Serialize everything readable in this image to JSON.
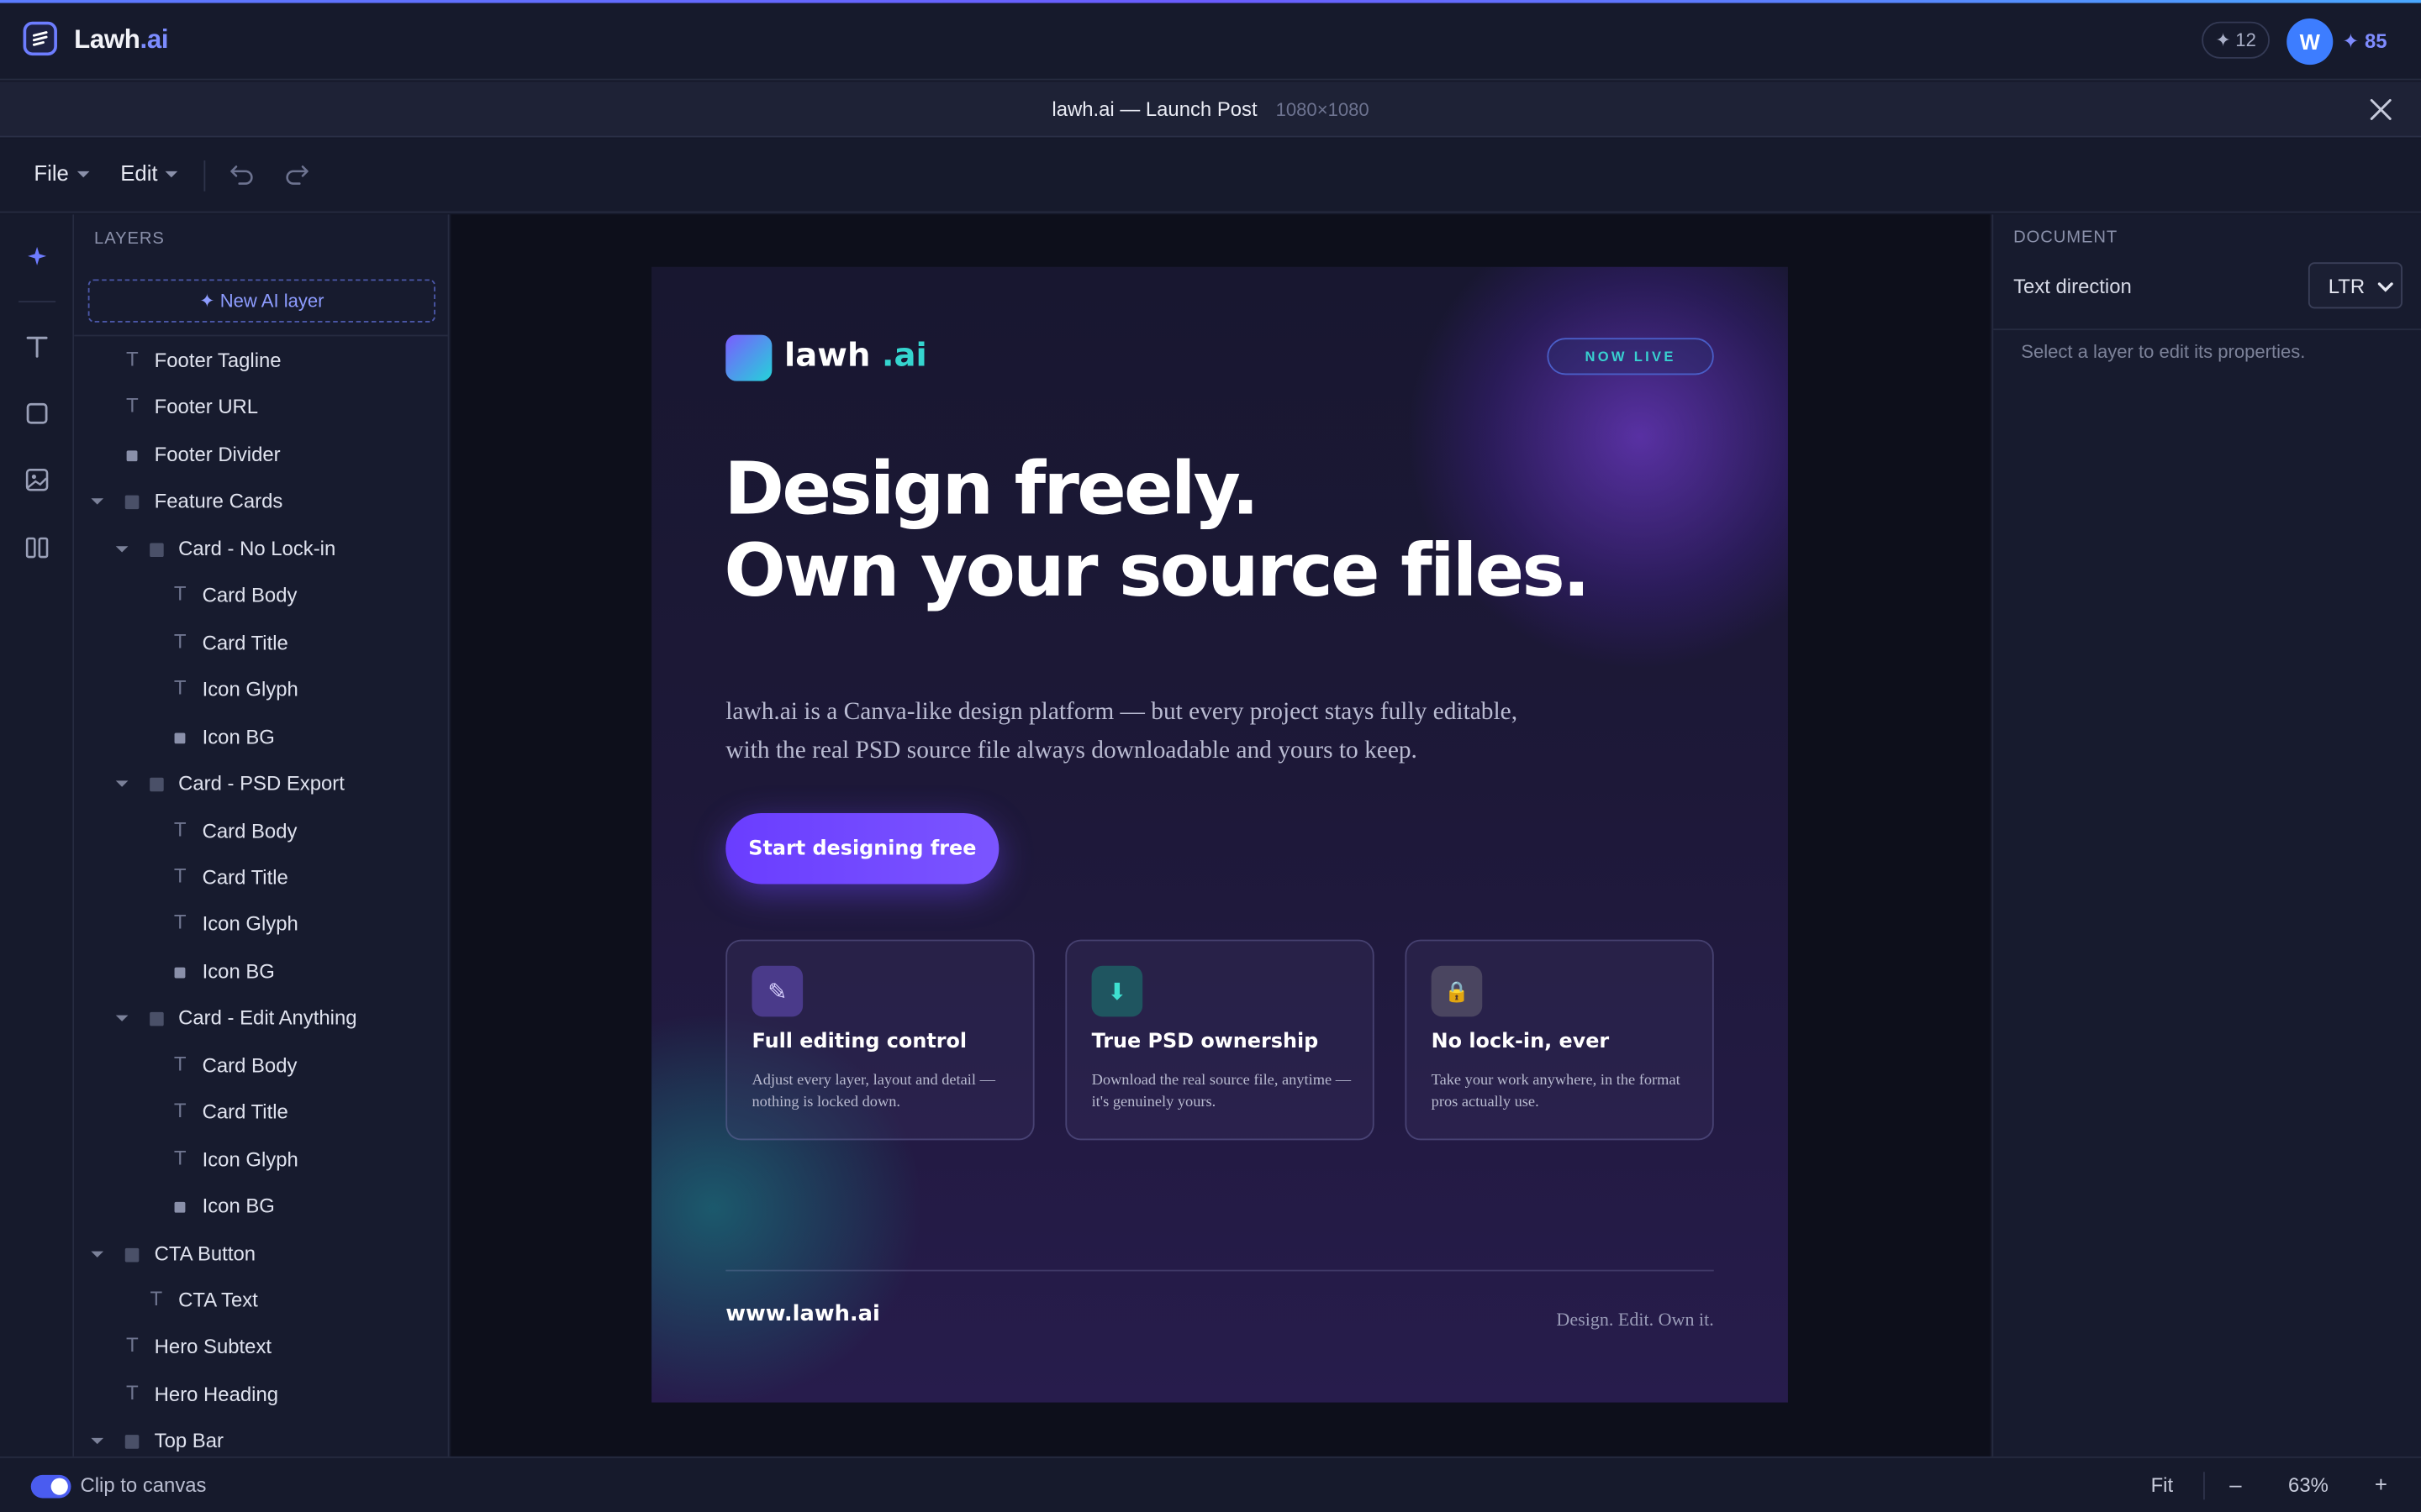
{
  "app": {
    "brand_name": "Lawh",
    "brand_suffix": ".ai",
    "credits_badge": "12",
    "avatar_initial": "W",
    "points": "85",
    "accent": "#5b7cff"
  },
  "document": {
    "title": "lawh.ai — Launch Post",
    "dimensions": "1080×1080"
  },
  "toolbar": {
    "file_label": "File",
    "edit_label": "Edit"
  },
  "layers": {
    "header": "LAYERS",
    "new_ai_label": "✦ New AI layer",
    "items": [
      {
        "label": "Footer Tagline",
        "kind": "text",
        "depth": 0,
        "expandable": false
      },
      {
        "label": "Footer URL",
        "kind": "text",
        "depth": 0,
        "expandable": false
      },
      {
        "label": "Footer Divider",
        "kind": "shape",
        "depth": 0,
        "expandable": false
      },
      {
        "label": "Feature Cards",
        "kind": "group",
        "depth": 0,
        "expandable": true
      },
      {
        "label": "Card - No Lock-in",
        "kind": "group",
        "depth": 1,
        "expandable": true
      },
      {
        "label": "Card Body",
        "kind": "text",
        "depth": 2,
        "expandable": false
      },
      {
        "label": "Card Title",
        "kind": "text",
        "depth": 2,
        "expandable": false
      },
      {
        "label": "Icon Glyph",
        "kind": "text",
        "depth": 2,
        "expandable": false
      },
      {
        "label": "Icon BG",
        "kind": "shape",
        "depth": 2,
        "expandable": false
      },
      {
        "label": "Card - PSD Export",
        "kind": "group",
        "depth": 1,
        "expandable": true
      },
      {
        "label": "Card Body",
        "kind": "text",
        "depth": 2,
        "expandable": false
      },
      {
        "label": "Card Title",
        "kind": "text",
        "depth": 2,
        "expandable": false
      },
      {
        "label": "Icon Glyph",
        "kind": "text",
        "depth": 2,
        "expandable": false
      },
      {
        "label": "Icon BG",
        "kind": "shape",
        "depth": 2,
        "expandable": false
      },
      {
        "label": "Card - Edit Anything",
        "kind": "group",
        "depth": 1,
        "expandable": true
      },
      {
        "label": "Card Body",
        "kind": "text",
        "depth": 2,
        "expandable": false
      },
      {
        "label": "Card Title",
        "kind": "text",
        "depth": 2,
        "expandable": false
      },
      {
        "label": "Icon Glyph",
        "kind": "text",
        "depth": 2,
        "expandable": false
      },
      {
        "label": "Icon BG",
        "kind": "shape",
        "depth": 2,
        "expandable": false
      },
      {
        "label": "CTA Button",
        "kind": "group",
        "depth": 0,
        "expandable": true
      },
      {
        "label": "CTA Text",
        "kind": "text",
        "depth": 1,
        "expandable": false
      },
      {
        "label": "Hero Subtext",
        "kind": "text",
        "depth": 0,
        "expandable": false
      },
      {
        "label": "Hero Heading",
        "kind": "text",
        "depth": 0,
        "expandable": false
      },
      {
        "label": "Top Bar",
        "kind": "group",
        "depth": 0,
        "expandable": true
      }
    ]
  },
  "artboard": {
    "logo_text": "lawh",
    "logo_suffix": ".ai",
    "badge": "NOW LIVE",
    "hero_line1": "Design freely.",
    "hero_line2": "Own your source files.",
    "subtext": "lawh.ai is a Canva-like design platform — but every project stays fully editable, with the real PSD source file always downloadable and yours to keep.",
    "cta": "Start designing free",
    "cards": [
      {
        "icon": "✎",
        "title": "Full editing control",
        "body": "Adjust every layer, layout and detail — nothing is locked down.",
        "icon_bg": "#4a3a8a"
      },
      {
        "icon": "⬇",
        "title": "True PSD ownership",
        "body": "Download the real source file, anytime — it's genuinely yours.",
        "icon_bg": "#1f5560"
      },
      {
        "icon": "🔒",
        "title": "No lock-in, ever",
        "body": "Take your work anywhere, in the format pros actually use.",
        "icon_bg": "#4a4560"
      }
    ],
    "url": "www.lawh.ai",
    "tagline": "Design. Edit. Own it."
  },
  "properties": {
    "header": "DOCUMENT",
    "text_direction_label": "Text direction",
    "text_direction_value": "LTR",
    "hint": "Select a layer to edit its properties."
  },
  "status": {
    "clip_label": "Clip to canvas",
    "fit_label": "Fit",
    "zoom_minus": "–",
    "zoom_value": "63%",
    "zoom_plus": "+"
  }
}
